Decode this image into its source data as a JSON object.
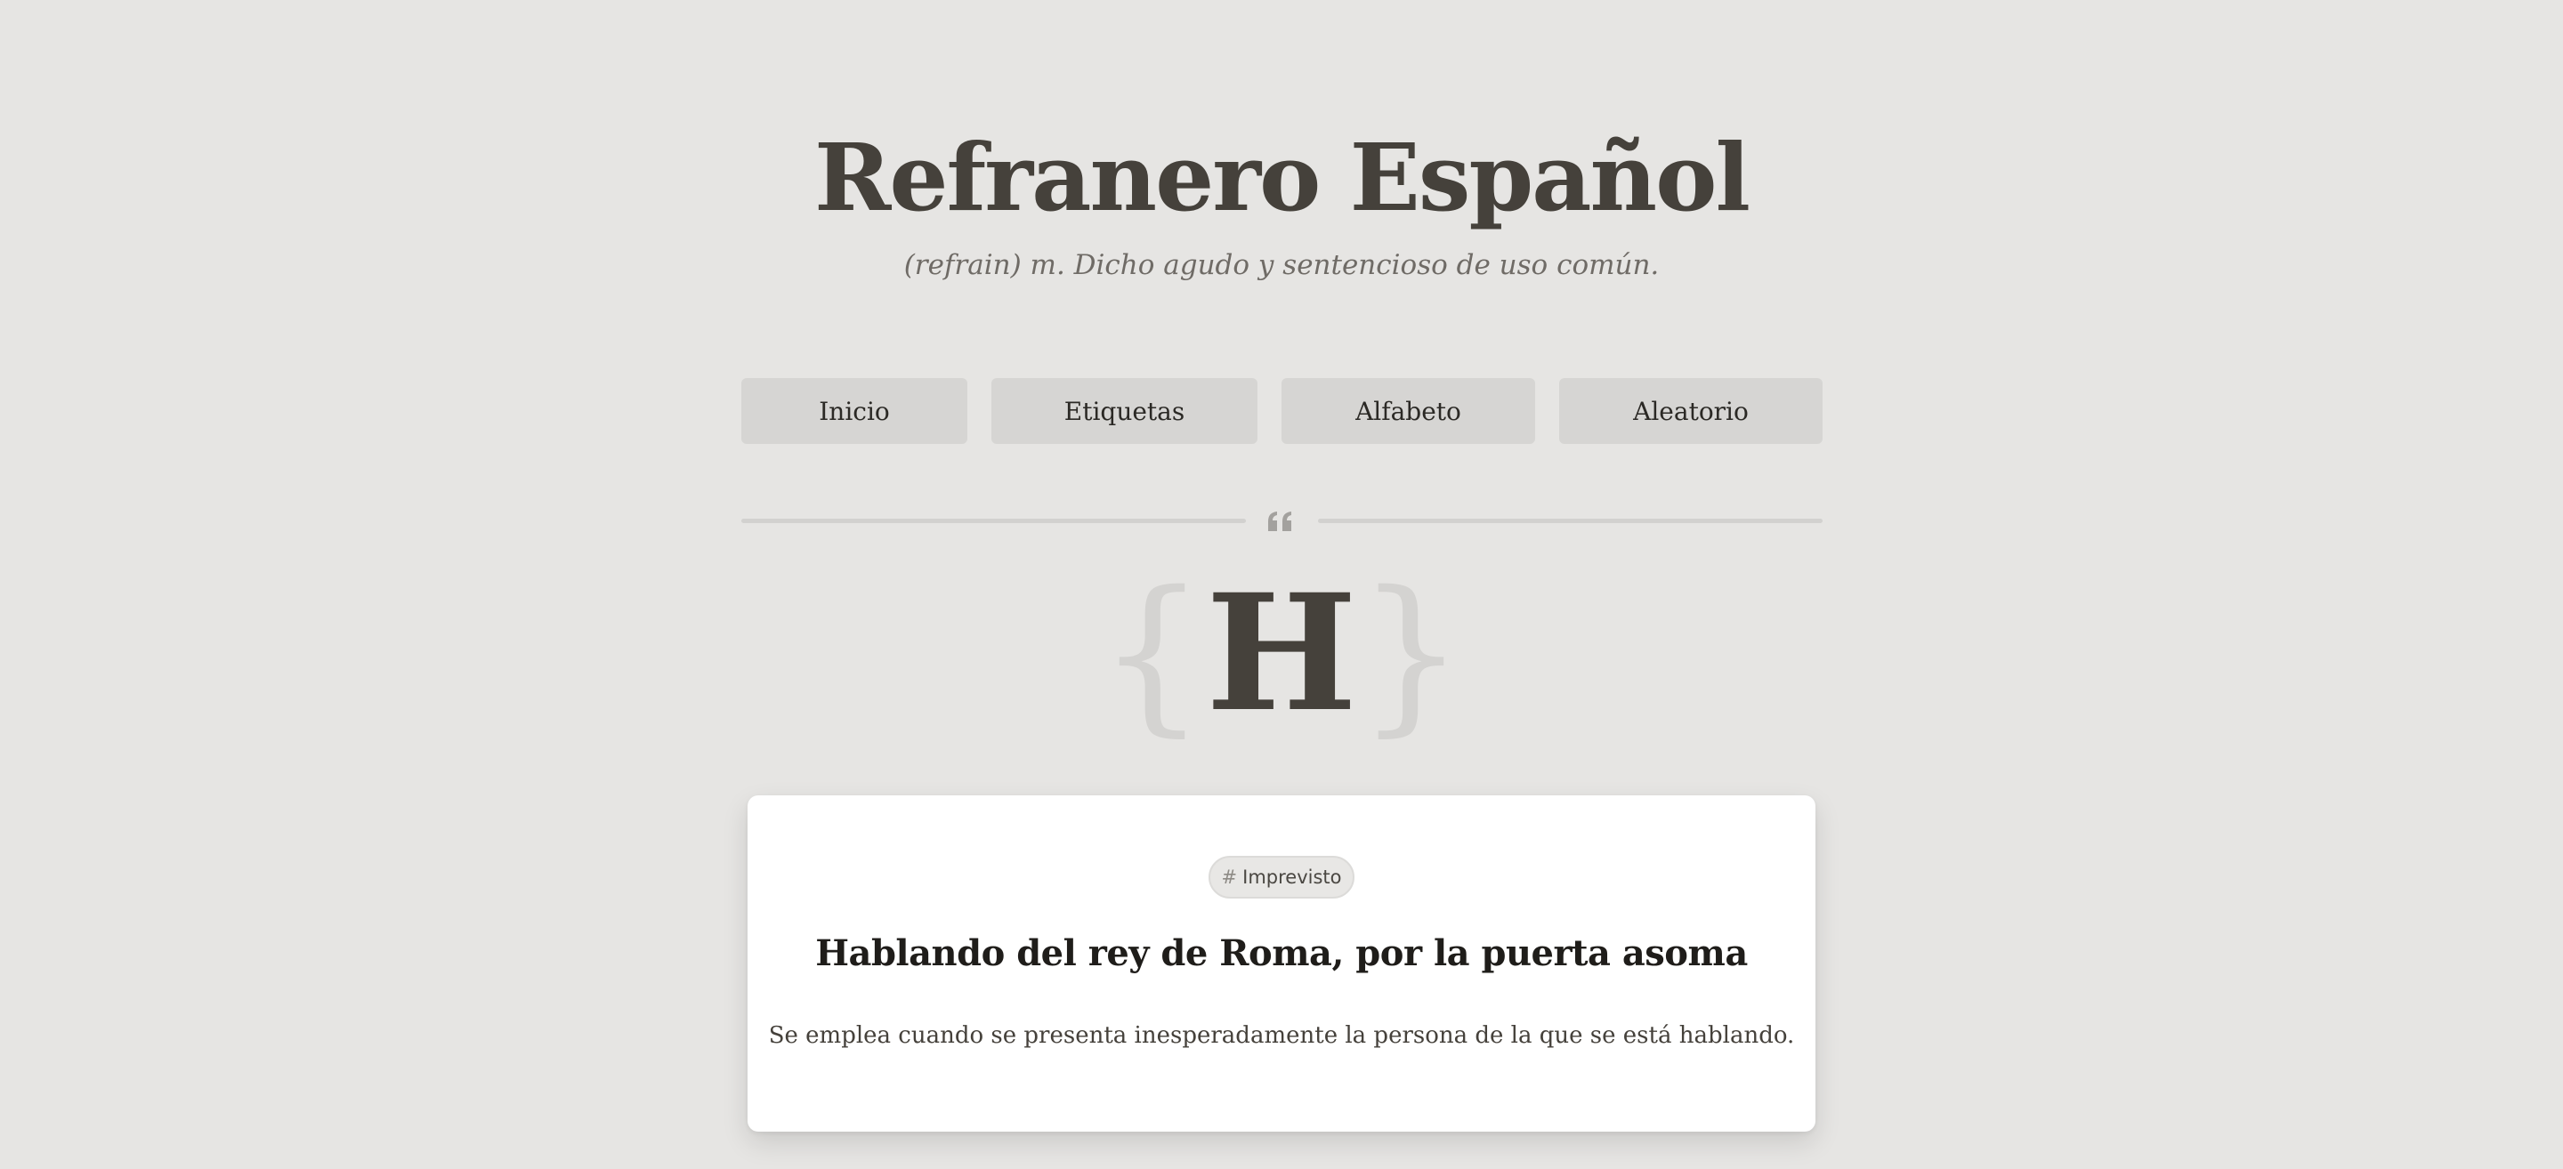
{
  "header": {
    "title": "Refranero Español",
    "tagline": "(refrain) m. Dicho agudo y sentencioso de uso común."
  },
  "nav": {
    "items": [
      {
        "label": "Inicio"
      },
      {
        "label": "Etiquetas"
      },
      {
        "label": "Alfabeto"
      },
      {
        "label": "Aleatorio"
      }
    ]
  },
  "divider": {
    "icon": "quote-icon"
  },
  "letter_heading": {
    "open_brace": "{",
    "letter": "H",
    "close_brace": "}"
  },
  "card": {
    "tag": {
      "hash": "#",
      "label": "Imprevisto"
    },
    "title": "Hablando del rey de Roma, por la puerta asoma",
    "description": "Se emplea cuando se presenta inesperadamente la persona de la que se está hablando."
  },
  "colors": {
    "background": "#e6e5e3",
    "nav_button": "#d6d5d3",
    "title_text": "#45413b",
    "card_background": "#ffffff"
  }
}
